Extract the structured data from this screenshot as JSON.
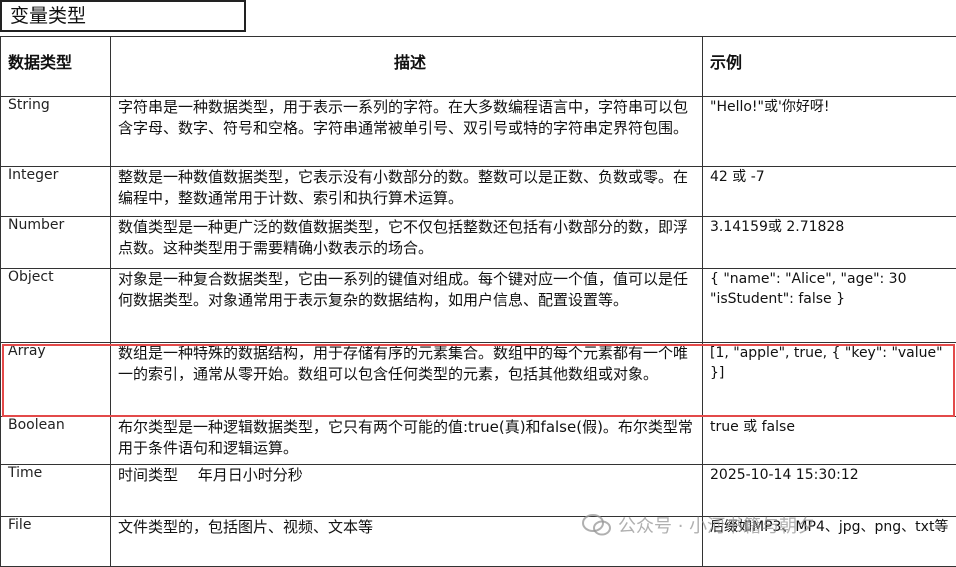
{
  "title": "变量类型",
  "headers": [
    "数据类型",
    "描述",
    "示例"
  ],
  "rows": [
    {
      "type": "String",
      "desc": "字符串是一种数据类型，用于表示一系列的字符。在大多数编程语言中，字符串可以包含字母、数字、符号和空格。字符串通常被单引号、双引号或特的字符串定界符包围。",
      "example": "\"Hello!\"或'你好呀!"
    },
    {
      "type": "Integer",
      "desc": "整数是一种数值数据类型，它表示没有小数部分的数。整数可以是正数、负数或零。在编程中，整数通常用于计数、索引和执行算术运算。",
      "example": "42 或 -7"
    },
    {
      "type": "Number",
      "desc": "数值类型是一种更广泛的数值数据类型，它不仅包括整数还包括有小数部分的数，即浮点数。这种类型用于需要精确小数表示的场合。",
      "example": "3.14159或 2.71828"
    },
    {
      "type": "Object",
      "desc": "对象是一种复合数据类型，它由一系列的键值对组成。每个键对应一个值，值可以是任何数据类型。对象通常用于表示复杂的数据结构，如用户信息、配置设置等。",
      "example": "{ \"name\": \"Alice\", \"age\": 30 \"isStudent\": false }"
    },
    {
      "type": "Array",
      "desc": "数组是一种特殊的数据结构，用于存储有序的元素集合。数组中的每个元素都有一个唯一的索引，通常从零开始。数组可以包含任何类型的元素，包括其他数组或对象。",
      "example": "[1, \"apple\", true, { \"key\": \"value\" }]"
    },
    {
      "type": "Boolean",
      "desc": "布尔类型是一种逻辑数据类型，它只有两个可能的值:true(真)和false(假)。布尔类型常用于条件语句和逻辑运算。",
      "example": "true 或 false"
    },
    {
      "type": "Time",
      "desc": "时间类型　 年月日小时分秒",
      "example": "2025-10-14 15:30:12"
    },
    {
      "type": "File",
      "desc": "文件类型的，包括图片、视频、文本等",
      "example": "后缀如MP3、MP4、jpg、png、txt等"
    }
  ],
  "highlighted_row": "Array",
  "watermark": "公众号 · 小河书籍与朝夕",
  "colors": {
    "highlight": "#e34a4a",
    "border": "#333333"
  }
}
